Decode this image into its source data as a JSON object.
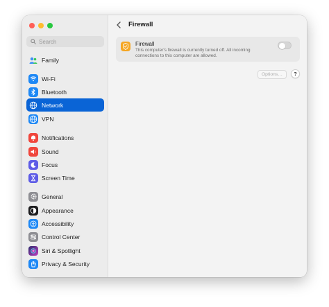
{
  "window": {
    "title": "Firewall"
  },
  "search": {
    "placeholder": "Search"
  },
  "sidebar": {
    "items": [
      {
        "label": "Family",
        "icon": "family-icon",
        "color": "#ffffff"
      },
      {
        "label": "Wi-Fi",
        "icon": "wifi-icon",
        "color": "#1e88f5"
      },
      {
        "label": "Bluetooth",
        "icon": "bluetooth-icon",
        "color": "#1e88f5"
      },
      {
        "label": "Network",
        "icon": "globe-icon",
        "color": "#1e88f5",
        "selected": true
      },
      {
        "label": "VPN",
        "icon": "vpn-globe-icon",
        "color": "#1e88f5"
      },
      {
        "label": "Notifications",
        "icon": "bell-icon",
        "color": "#f0463c"
      },
      {
        "label": "Sound",
        "icon": "speaker-icon",
        "color": "#f0463c"
      },
      {
        "label": "Focus",
        "icon": "moon-icon",
        "color": "#5e5ce6"
      },
      {
        "label": "Screen Time",
        "icon": "hourglass-icon",
        "color": "#5e5ce6"
      },
      {
        "label": "General",
        "icon": "gear-icon",
        "color": "#8e8e93"
      },
      {
        "label": "Appearance",
        "icon": "appearance-icon",
        "color": "#1c1c1e"
      },
      {
        "label": "Accessibility",
        "icon": "accessibility-icon",
        "color": "#1e88f5"
      },
      {
        "label": "Control Center",
        "icon": "control-center-icon",
        "color": "#8e8e93"
      },
      {
        "label": "Siri & Spotlight",
        "icon": "siri-icon",
        "color": "#6b3fd6"
      },
      {
        "label": "Privacy & Security",
        "icon": "hand-icon",
        "color": "#1e88f5"
      }
    ]
  },
  "firewall": {
    "name": "Firewall",
    "description": "This computer's firewall is currently turned off. All incoming connections to this computer are allowed.",
    "toggle_on": false,
    "icon_color": "#f5a623"
  },
  "buttons": {
    "options": "Options…",
    "help": "?"
  },
  "colors": {
    "accent": "#0a64d6"
  }
}
